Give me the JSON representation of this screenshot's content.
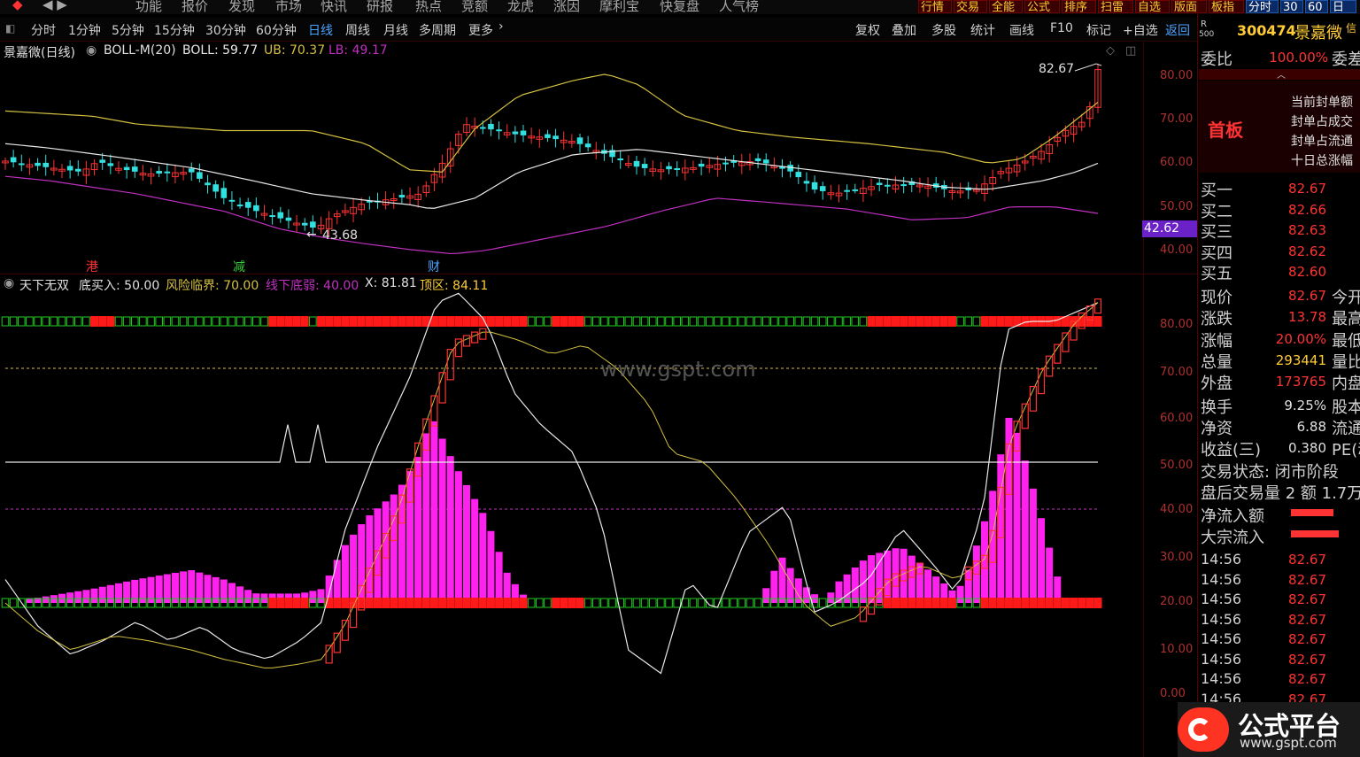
{
  "menubar": {
    "items": [
      "功能",
      "报价",
      "发现",
      "市场",
      "快讯",
      "研报",
      "热点",
      "竞额",
      "龙虎",
      "涨因",
      "摩利宝",
      "快复盘",
      "人气榜"
    ],
    "tags": [
      "行情",
      "交易",
      "全能",
      "公式",
      "排序",
      "扫雷",
      "自选",
      "版面",
      "板指",
      "分时",
      "30",
      "60",
      "日"
    ]
  },
  "toolbar": {
    "periods": [
      "分时",
      "1分钟",
      "5分钟",
      "15分钟",
      "30分钟",
      "60分钟",
      "日线",
      "周线",
      "月线",
      "多周期",
      "更多"
    ],
    "active_period": "日线",
    "tools": [
      "复权",
      "叠加",
      "多股",
      "统计",
      "画线",
      "F10",
      "标记",
      "+自选",
      "返回"
    ]
  },
  "price_panel": {
    "indicator_title": "景嘉微(日线)",
    "indicator_name": "BOLL-M(20)",
    "boll": "BOLL: 59.77",
    "ub": "UB: 70.37",
    "lb": "LB: 49.17",
    "high_label": "82.67",
    "low_label": "43.68",
    "current_price_tag": "42.62",
    "axis": [
      "80.00",
      "70.00",
      "60.00",
      "50.00",
      "40.00"
    ],
    "events": [
      {
        "label": "港",
        "color": "#ff3333"
      },
      {
        "label": "减",
        "color": "#33cc33"
      },
      {
        "label": "财",
        "color": "#4aa3ff"
      }
    ]
  },
  "indicator_panel": {
    "name": "天下无双",
    "buy_label": "底买入: 50.00",
    "risk_label": "风险临界: 70.00",
    "weak_label": "线下底弱: 40.00",
    "x_label": "X: 81.81",
    "top_label": "顶区: 84.11",
    "axis": [
      "80.00",
      "70.00",
      "60.00",
      "50.00",
      "40.00",
      "30.00",
      "20.00",
      "10.00",
      "0.00"
    ],
    "watermark": "www.gspt.com"
  },
  "stock": {
    "code": "300474",
    "name": "景嘉微",
    "r_label": "R",
    "r_sub": "500",
    "extra": "信"
  },
  "right_panel": {
    "weibi_label": "委比",
    "weibi_value": "100.00%",
    "weibi_extra": "委差",
    "first_board": "首板",
    "seal_lines": [
      "当前封单额",
      "封单占成交",
      "封单占流通",
      "十日总涨幅"
    ],
    "bids": [
      {
        "label": "买一",
        "value": "82.67"
      },
      {
        "label": "买二",
        "value": "82.66"
      },
      {
        "label": "买三",
        "value": "82.63"
      },
      {
        "label": "买四",
        "value": "82.62"
      },
      {
        "label": "买五",
        "value": "82.60"
      }
    ],
    "quotes": [
      {
        "label": "现价",
        "value": "82.67",
        "color": "#ff3333",
        "extra": "今开"
      },
      {
        "label": "涨跌",
        "value": "13.78",
        "color": "#ff3333",
        "extra": "最高"
      },
      {
        "label": "涨幅",
        "value": "20.00%",
        "color": "#ff3333",
        "extra": "最低"
      },
      {
        "label": "总量",
        "value": "293441",
        "color": "#ffcc33",
        "extra": "量比"
      },
      {
        "label": "外盘",
        "value": "173765",
        "color": "#ff3333",
        "extra": "内盘"
      },
      {
        "label": "换手",
        "value": "9.25%",
        "color": "#e0e0e0",
        "extra": "股本"
      },
      {
        "label": "净资",
        "value": "6.88",
        "color": "#e0e0e0",
        "extra": "流通"
      },
      {
        "label": "收益(三)",
        "value": "0.380",
        "color": "#e0e0e0",
        "extra": "PE(动"
      }
    ],
    "trade_status": "交易状态: 闭市阶段",
    "after_hours": "盘后交易量 2 额 1.7万",
    "net_inflow_label": "净流入额",
    "block_inflow_label": "大宗流入",
    "ticks": [
      {
        "time": "14:56",
        "price": "82.67"
      },
      {
        "time": "14:56",
        "price": "82.67"
      },
      {
        "time": "14:56",
        "price": "82.67"
      },
      {
        "time": "14:56",
        "price": "82.67"
      },
      {
        "time": "14:56",
        "price": "82.67"
      },
      {
        "time": "14:56",
        "price": "82.67"
      },
      {
        "time": "14:56",
        "price": "82.67"
      },
      {
        "time": "14:56",
        "price": "82.67"
      }
    ]
  },
  "logo": {
    "text": "公式平台",
    "url_text": "www.gspt.com"
  },
  "colors": {
    "up": "#ff3333",
    "down": "#33e0e0",
    "ub": "#d4c040",
    "mid": "#e8e8e8",
    "lb": "#c030c0",
    "magenta_bar": "#ff22ee",
    "green_block": "#22cc22",
    "red_block": "#ff1a1a"
  }
}
